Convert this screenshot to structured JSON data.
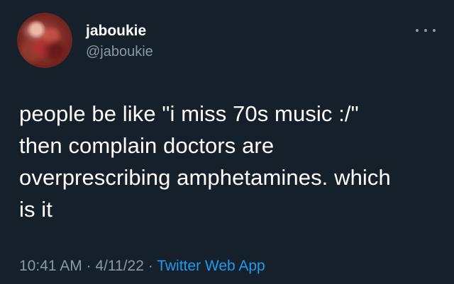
{
  "author": {
    "display_name": "jaboukie",
    "handle": "@jaboukie",
    "avatar_icon": "profile-photo"
  },
  "more_icon": "more-horizontal-icon",
  "tweet": {
    "lines": [
      "people be like \"i miss 70s music :/\"",
      "then complain doctors are",
      "overprescribing amphetamines. which",
      "is it"
    ]
  },
  "meta": {
    "time": "10:41 AM",
    "separator": "·",
    "date": "4/11/22",
    "source": "Twitter Web App"
  },
  "colors": {
    "background": "#15202b",
    "text": "#ffffff",
    "secondary_text": "#8b98a5",
    "link": "#1d9bf0"
  }
}
